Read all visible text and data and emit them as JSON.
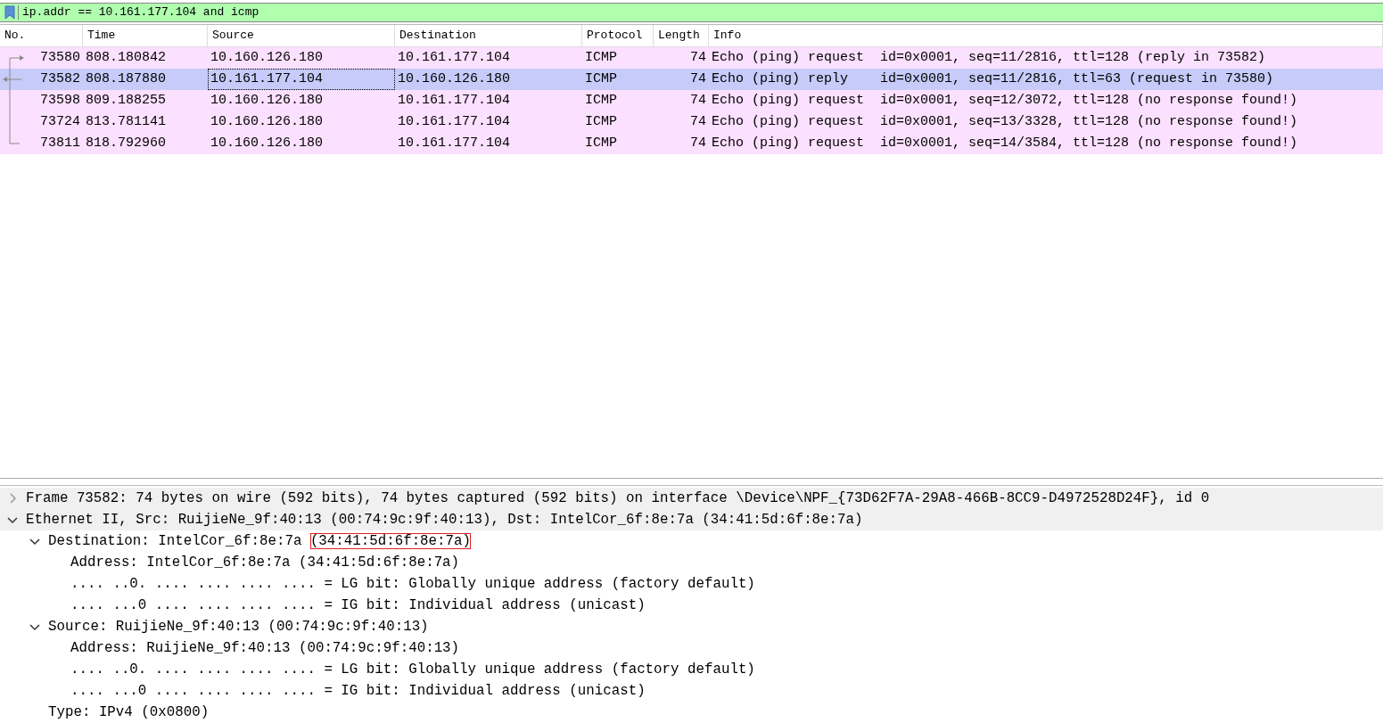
{
  "filter": {
    "value": "ip.addr == 10.161.177.104 and icmp"
  },
  "columns": [
    "No.",
    "Time",
    "Source",
    "Destination",
    "Protocol",
    "Length",
    "Info"
  ],
  "packets": [
    {
      "no": "73580",
      "time": "808.180842",
      "source": "10.160.126.180",
      "destination": "10.161.177.104",
      "protocol": "ICMP",
      "length": "74",
      "info": "Echo (ping) request  id=0x0001, seq=11/2816, ttl=128 (reply in 73582)",
      "kind": "first",
      "selected": false
    },
    {
      "no": "73582",
      "time": "808.187880",
      "source": "10.161.177.104",
      "destination": "10.160.126.180",
      "protocol": "ICMP",
      "length": "74",
      "info": "Echo (ping) reply    id=0x0001, seq=11/2816, ttl=63 (request in 73580)",
      "kind": "response",
      "selected": true
    },
    {
      "no": "73598",
      "time": "809.188255",
      "source": "10.160.126.180",
      "destination": "10.161.177.104",
      "protocol": "ICMP",
      "length": "74",
      "info": "Echo (ping) request  id=0x0001, seq=12/3072, ttl=128 (no response found!)",
      "kind": "middle",
      "selected": false
    },
    {
      "no": "73724",
      "time": "813.781141",
      "source": "10.160.126.180",
      "destination": "10.161.177.104",
      "protocol": "ICMP",
      "length": "74",
      "info": "Echo (ping) request  id=0x0001, seq=13/3328, ttl=128 (no response found!)",
      "kind": "middle",
      "selected": false
    },
    {
      "no": "73811",
      "time": "818.792960",
      "source": "10.160.126.180",
      "destination": "10.161.177.104",
      "protocol": "ICMP",
      "length": "74",
      "info": "Echo (ping) request  id=0x0001, seq=14/3584, ttl=128 (no response found!)",
      "kind": "last",
      "selected": false
    }
  ],
  "details": [
    {
      "label": "Frame 73582: 74 bytes on wire (592 bits), 74 bytes captured (592 bits) on interface \\Device\\NPF_{73D62F7A-29A8-466B-8CC9-D4972528D24F}, id 0",
      "expanded": false
    },
    {
      "label": "Ethernet II, Src: RuijieNe_9f:40:13 (00:74:9c:9f:40:13), Dst: IntelCor_6f:8e:7a (34:41:5d:6f:8e:7a)",
      "expanded": true,
      "children": [
        {
          "label": "Destination: IntelCor_6f:8e:7a ",
          "highlight": "(34:41:5d:6f:8e:7a)",
          "expanded": true,
          "children": [
            {
              "label": "Address: IntelCor_6f:8e:7a (34:41:5d:6f:8e:7a)"
            },
            {
              "label": ".... ..0. .... .... .... .... = LG bit: Globally unique address (factory default)"
            },
            {
              "label": ".... ...0 .... .... .... .... = IG bit: Individual address (unicast)"
            }
          ]
        },
        {
          "label": "Source: RuijieNe_9f:40:13 (00:74:9c:9f:40:13)",
          "expanded": true,
          "children": [
            {
              "label": "Address: RuijieNe_9f:40:13 (00:74:9c:9f:40:13)"
            },
            {
              "label": ".... ..0. .... .... .... .... = LG bit: Globally unique address (factory default)"
            },
            {
              "label": ".... ...0 .... .... .... .... = IG bit: Individual address (unicast)"
            }
          ]
        },
        {
          "label": "Type: IPv4 (0x0800)"
        }
      ]
    }
  ]
}
